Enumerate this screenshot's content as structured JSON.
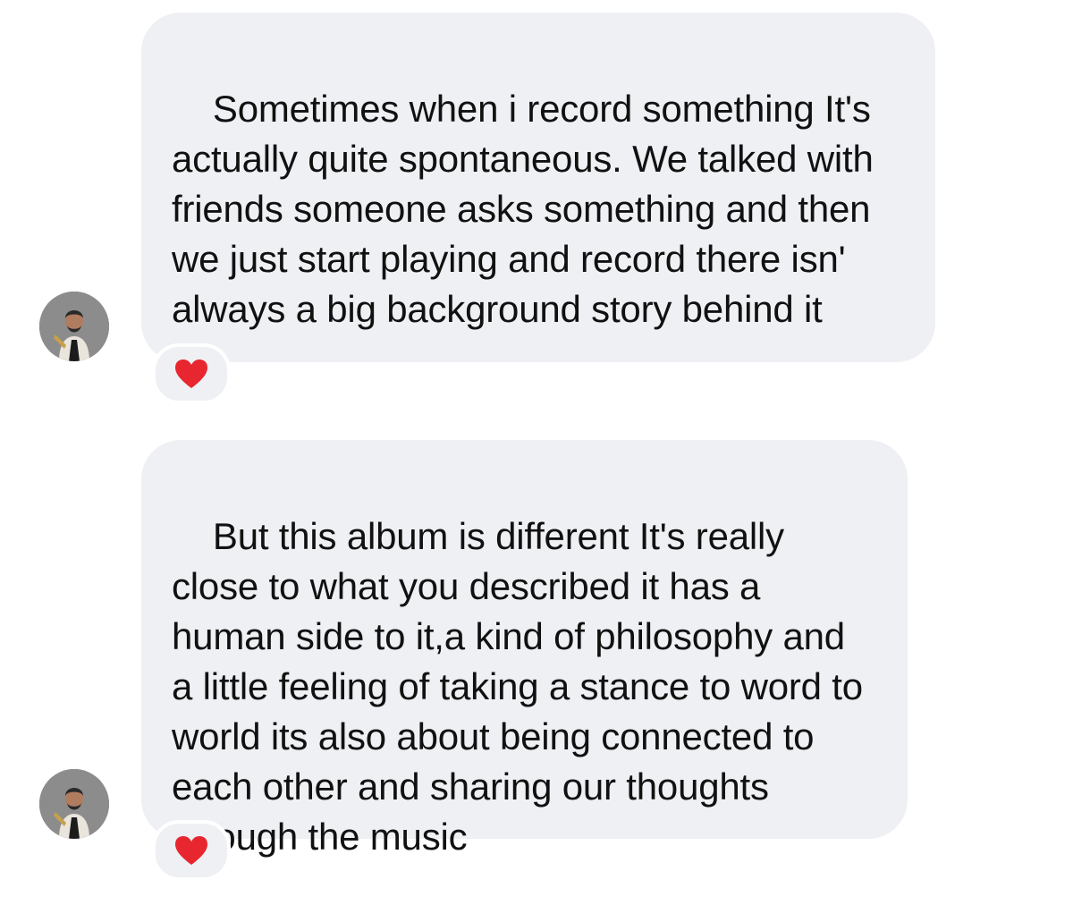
{
  "messages": [
    {
      "text": "Sometimes when i record something It's actually quite spontaneous. We talked with friends someone asks something and then we just start playing and record there isn' always a big background story behind it",
      "reaction": "red-heart"
    },
    {
      "text": "But this album is different It's really close to what you described it has a human side to it,a kind of philosophy and a little feeling of taking a stance to word to world its also about being connected to each other and sharing our thoughts through the music",
      "reaction": "red-heart"
    }
  ],
  "colors": {
    "bubble": "#eef0f3",
    "text": "#111111",
    "heart": "#e8262f"
  }
}
